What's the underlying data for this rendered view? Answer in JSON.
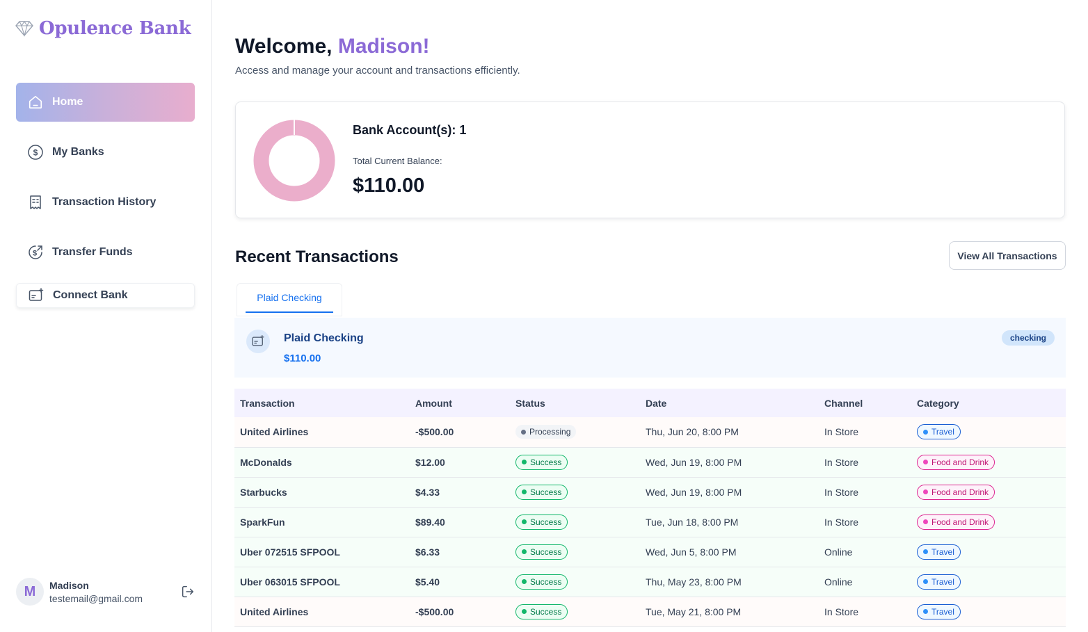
{
  "app": {
    "name": "Opulence Bank",
    "brand_color": "#8b6ad6"
  },
  "sidebar": {
    "items": [
      {
        "label": "Home",
        "icon": "home-icon",
        "active": true
      },
      {
        "label": "My Banks",
        "icon": "dollar-circle-icon",
        "active": false
      },
      {
        "label": "Transaction History",
        "icon": "receipt-icon",
        "active": false
      },
      {
        "label": "Transfer Funds",
        "icon": "money-send-icon",
        "active": false
      }
    ],
    "connect_bank": {
      "label": "Connect Bank",
      "icon": "connect-bank-icon"
    }
  },
  "user": {
    "initial": "M",
    "name": "Madison",
    "email": "testemail@gmail.com"
  },
  "header": {
    "greeting": "Welcome,",
    "name": "Madison!",
    "subtext": "Access and manage your account and transactions efficiently."
  },
  "balance": {
    "accounts_label": "Bank Account(s): 1",
    "total_label": "Total Current Balance:",
    "total_amount": "$110.00",
    "donut_color": "#ebaecb"
  },
  "recent": {
    "title": "Recent Transactions",
    "view_all": "View All Transactions",
    "tabs": [
      {
        "label": "Plaid Checking",
        "active": true
      }
    ]
  },
  "bank": {
    "name": "Plaid Checking",
    "balance": "$110.00",
    "type": "checking"
  },
  "table": {
    "headers": [
      "Transaction",
      "Amount",
      "Status",
      "Date",
      "Channel",
      "Category"
    ],
    "rows": [
      {
        "name": "United Airlines",
        "amount": "-$500.00",
        "type": "debit",
        "status": "Processing",
        "date": "Thu, Jun 20, 8:00 PM",
        "channel": "In Store",
        "category": "Travel"
      },
      {
        "name": "McDonalds",
        "amount": "$12.00",
        "type": "credit",
        "status": "Success",
        "date": "Wed, Jun 19, 8:00 PM",
        "channel": "In Store",
        "category": "Food and Drink"
      },
      {
        "name": "Starbucks",
        "amount": "$4.33",
        "type": "credit",
        "status": "Success",
        "date": "Wed, Jun 19, 8:00 PM",
        "channel": "In Store",
        "category": "Food and Drink"
      },
      {
        "name": "SparkFun",
        "amount": "$89.40",
        "type": "credit",
        "status": "Success",
        "date": "Tue, Jun 18, 8:00 PM",
        "channel": "In Store",
        "category": "Food and Drink"
      },
      {
        "name": "Uber 072515 SFPOOL",
        "amount": "$6.33",
        "type": "credit",
        "status": "Success",
        "date": "Wed, Jun 5, 8:00 PM",
        "channel": "Online",
        "category": "Travel"
      },
      {
        "name": "Uber 063015 SFPOOL",
        "amount": "$5.40",
        "type": "credit",
        "status": "Success",
        "date": "Thu, May 23, 8:00 PM",
        "channel": "Online",
        "category": "Travel"
      },
      {
        "name": "United Airlines",
        "amount": "-$500.00",
        "type": "debit",
        "status": "Success",
        "date": "Tue, May 21, 8:00 PM",
        "channel": "In Store",
        "category": "Travel"
      }
    ]
  }
}
